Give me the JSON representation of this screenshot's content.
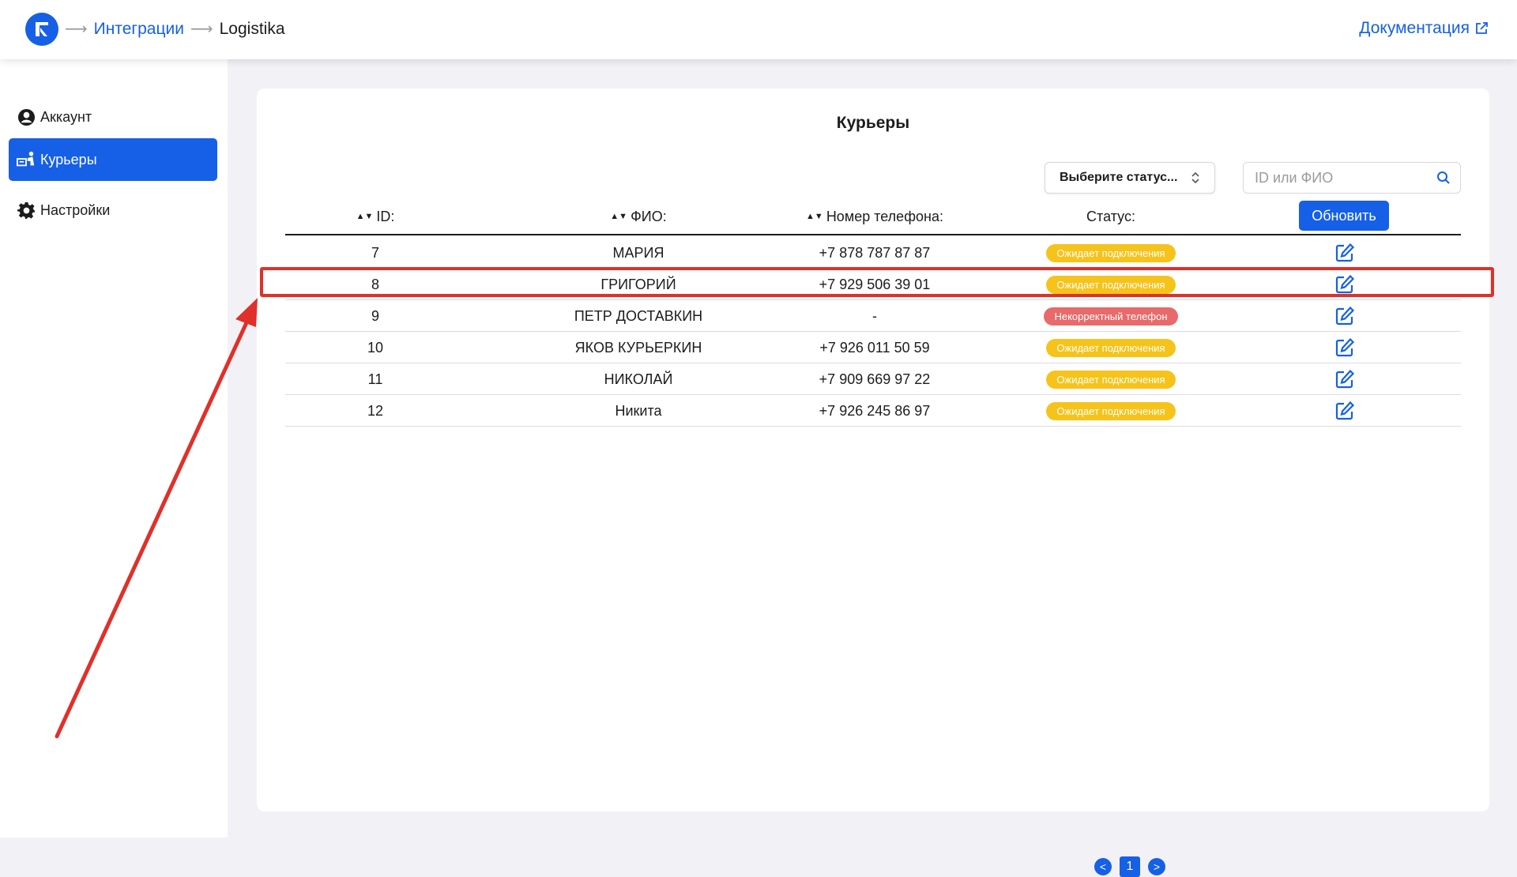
{
  "header": {
    "breadcrumb": {
      "arrow": "⟶",
      "integrations": "Интеграции",
      "current": "Logistika"
    },
    "documentation": "Документация"
  },
  "sidebar": {
    "items": [
      {
        "label": "Аккаунт",
        "icon": "user-circle-icon",
        "active": false
      },
      {
        "label": "Курьеры",
        "icon": "courier-icon",
        "active": true
      },
      {
        "label": "Настройки",
        "icon": "gear-icon",
        "active": false
      }
    ]
  },
  "main": {
    "title": "Курьеры",
    "status_select": "Выберите статус...",
    "search_placeholder": "ID или ФИО",
    "refresh_button": "Обновить",
    "columns": {
      "id": "ID:",
      "name": "ФИО:",
      "phone": "Номер телефона:",
      "status": "Статус:"
    },
    "rows": [
      {
        "id": "7",
        "name": "МАРИЯ",
        "phone": "+7 878 787 87 87",
        "status": "Ожидает подключения",
        "status_type": "wait"
      },
      {
        "id": "8",
        "name": "ГРИГОРИЙ",
        "phone": "+7 929 506 39 01",
        "status": "Ожидает подключения",
        "status_type": "wait"
      },
      {
        "id": "9",
        "name": "ПЕТР ДОСТАВКИН",
        "phone": "-",
        "status": "Некорректный телефон",
        "status_type": "bad"
      },
      {
        "id": "10",
        "name": "ЯКОВ КУРЬЕРКИН",
        "phone": "+7 926 011 50 59",
        "status": "Ожидает подключения",
        "status_type": "wait"
      },
      {
        "id": "11",
        "name": "НИКОЛАЙ",
        "phone": "+7 909 669 97 22",
        "status": "Ожидает подключения",
        "status_type": "wait"
      },
      {
        "id": "12",
        "name": "Никита",
        "phone": "+7 926 245 86 97",
        "status": "Ожидает подключения",
        "status_type": "wait"
      }
    ],
    "pagination": {
      "prev": "<",
      "page": "1",
      "next": ">"
    }
  },
  "colors": {
    "accent": "#1560e6",
    "status_wait": "#f6c31a",
    "status_bad": "#e86a6a",
    "annotation": "#e0302a"
  }
}
